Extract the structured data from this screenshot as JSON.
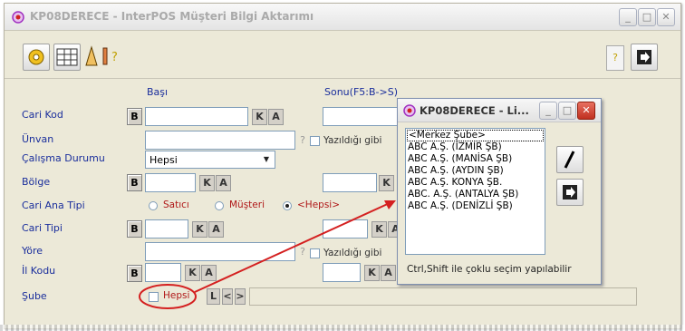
{
  "window": {
    "title": "KP08DERECE - InterPOS Müşteri Bilgi Aktarımı"
  },
  "toolbar": {
    "help_glyph": "?"
  },
  "form": {
    "header_start": "Başı",
    "header_end": "Sonu(F5:B->S)",
    "labels": {
      "cari_kod": "Cari Kod",
      "unvan": "Ünvan",
      "calisma": "Çalışma Durumu",
      "bolge": "Bölge",
      "cari_ana_tipi": "Cari Ana Tipi",
      "cari_tipi": "Cari Tipi",
      "yore": "Yöre",
      "il_kodu": "İl Kodu",
      "sube": "Şube"
    },
    "calisma_value": "Hepsi",
    "yazildigi_gibi": "Yazıldığı gibi",
    "radio": {
      "satici": "Satıcı",
      "musteri": "Müşteri",
      "hepsi": "<Hepsi>"
    },
    "sube_hepsi": "Hepsi",
    "btn_b": "B",
    "btn_k": "K",
    "btn_a": "A",
    "btn_l": "L",
    "btn_prev": "<",
    "btn_next": ">",
    "q": "?"
  },
  "popup": {
    "title": "KP08DERECE - Li...",
    "items": [
      "<Merkez Şube>",
      "ABC A.Ş. (İZMİR ŞB)",
      "ABC A.Ş. (MANİSA ŞB)",
      "ABC A.Ş. (AYDIN ŞB)",
      "ABC A.Ş. KONYA ŞB.",
      "ABC. A.Ş. (ANTALYA ŞB)",
      "ABC A.Ş. (DENİZLİ ŞB)"
    ],
    "hint": "Ctrl,Shift ile çoklu seçim yapılabilir"
  },
  "colors": {
    "label": "#1a2e9c",
    "annotation": "#d42020",
    "accent_red": "#b01818"
  }
}
